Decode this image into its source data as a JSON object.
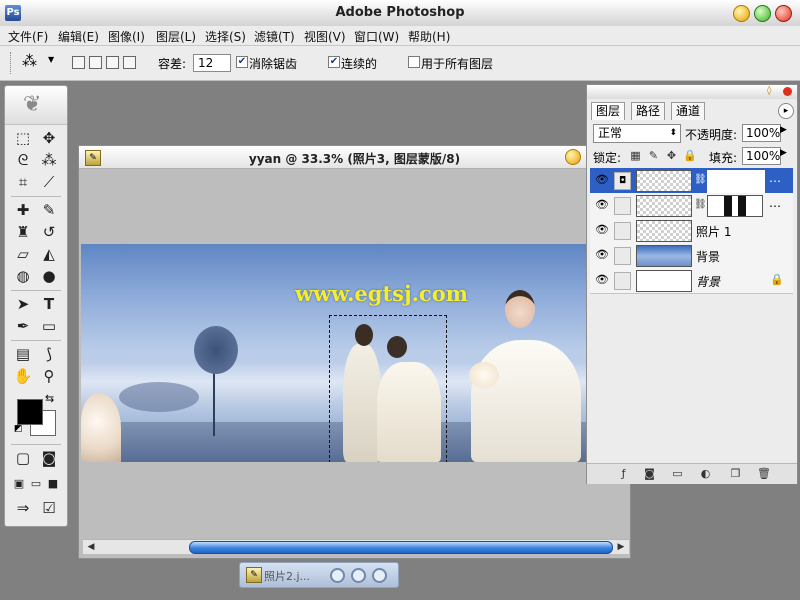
{
  "app": {
    "title": "Adobe Photoshop",
    "logo": "Ps"
  },
  "menu": [
    "文件(F)",
    "编辑(E)",
    "图像(I)",
    "图层(L)",
    "选择(S)",
    "滤镜(T)",
    "视图(V)",
    "窗口(W)",
    "帮助(H)"
  ],
  "options": {
    "tolerance_label": "容差:",
    "tolerance_value": "12",
    "anti_alias_label": "消除锯齿",
    "anti_alias_checked": "✔",
    "contiguous_label": "连续的",
    "contiguous_checked": "✔",
    "all_layers_label": "用于所有图层",
    "all_layers_checked": ""
  },
  "document": {
    "title": "yyan @ 33.3% (照片3, 图层蒙版/8)",
    "watermark": "www.egtsj.com"
  },
  "minimized_doc": {
    "title": "照片2.j..."
  },
  "layers_panel": {
    "tabs": [
      "图层",
      "路径",
      "通道"
    ],
    "blend_mode": "正常",
    "opacity_label": "不透明度:",
    "opacity_value": "100%",
    "lock_label": "锁定:",
    "fill_label": "填充:",
    "fill_value": "100%",
    "layers": [
      {
        "name": "",
        "visible": true,
        "selected": true,
        "has_mask": true
      },
      {
        "name": "",
        "visible": true,
        "selected": false,
        "has_mask": true
      },
      {
        "name": "照片 1",
        "visible": true,
        "selected": false,
        "has_mask": false
      },
      {
        "name": "背景",
        "visible": true,
        "selected": false,
        "has_mask": false
      },
      {
        "name": "背景",
        "visible": true,
        "selected": false,
        "has_mask": false,
        "locked": true
      }
    ]
  },
  "colors": {
    "foreground": "#000000",
    "background": "#ffffff",
    "selection_blue": "#2d5fc4",
    "scrollbar": "#3a82e0"
  }
}
